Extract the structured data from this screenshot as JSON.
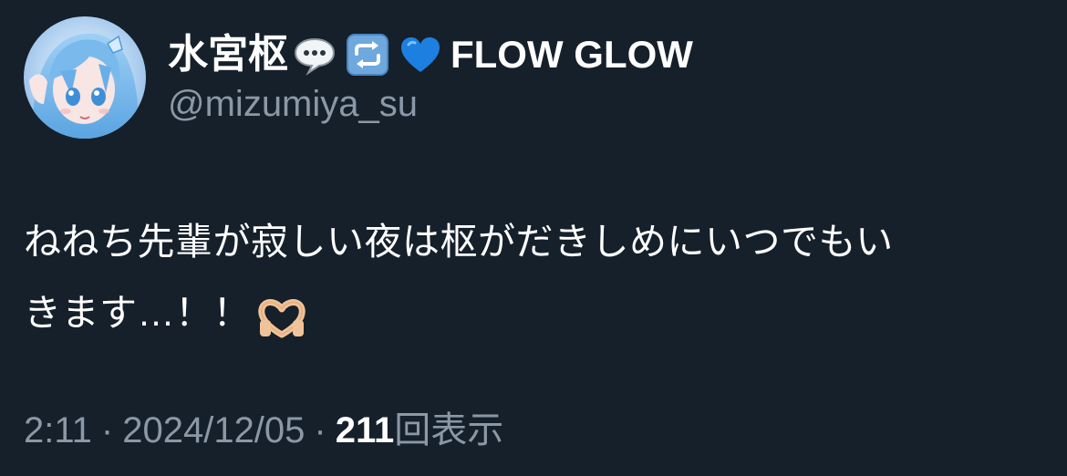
{
  "author": {
    "display_name": "水宮枢",
    "name_emojis": [
      "speech-balloon",
      "repeat-arrows",
      "blue-heart"
    ],
    "name_suffix": "FLOW GLOW",
    "handle": "@mizumiya_su"
  },
  "tweet": {
    "lines": [
      "ねねち先輩が寂しい夜は枢がだきしめにいつでもい",
      "きます…！！"
    ],
    "trailing_emoji": "heart-hands"
  },
  "meta": {
    "time": "2:11",
    "separator": "·",
    "date": "2024/12/05",
    "views_count": "211",
    "views_label": "回表示"
  },
  "colors": {
    "background": "#15202b",
    "primary_text": "#ffffff",
    "secondary_text": "#8b98a5",
    "emoji_blue_heart": "#1d9bf0"
  }
}
